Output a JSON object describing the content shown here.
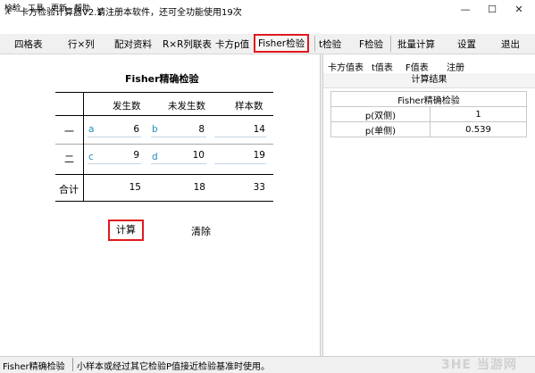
{
  "window": {
    "title": "卡方检验计算器V2.1",
    "note": "请注册本软件，还可全功能使用19次",
    "minimize": "—",
    "maximize": "☐",
    "close": "✕"
  },
  "menu": [
    "检验",
    "工具",
    "更新",
    "帮助"
  ],
  "toolbar": {
    "items": [
      "四格表",
      "行×列",
      "配对资料",
      "R×R列联表",
      "卡方p值",
      "Fisher检验",
      "t检验",
      "F检验",
      "批量计算",
      "设置",
      "退出"
    ],
    "selected": "Fisher检验"
  },
  "fisher": {
    "heading": "Fisher精确检验",
    "col_headers": [
      "发生数",
      "未发生数",
      "样本数"
    ],
    "rows": [
      {
        "label": "一",
        "letter1": "a",
        "v1": "6",
        "letter2": "b",
        "v2": "8",
        "total": "14"
      },
      {
        "label": "二",
        "letter1": "c",
        "v1": "9",
        "letter2": "d",
        "v2": "10",
        "total": "19"
      }
    ],
    "sum_row": {
      "label": "合计",
      "v1": "15",
      "v2": "18",
      "total": "33"
    },
    "calc_label": "计算",
    "clear_label": "清除"
  },
  "right": {
    "tabs": [
      "卡方值表",
      "t值表",
      "F值表",
      "注册"
    ],
    "caption": "计算结果",
    "table_title": "Fisher精确检验",
    "results": [
      {
        "label": "p(双侧)",
        "value": "1"
      },
      {
        "label": "p(单侧)",
        "value": "0.539"
      }
    ]
  },
  "status": {
    "left": "Fisher精确检验",
    "message": "小样本或经过其它检验P值接近检验基准时使用。"
  },
  "watermark": "3HE 当游网"
}
